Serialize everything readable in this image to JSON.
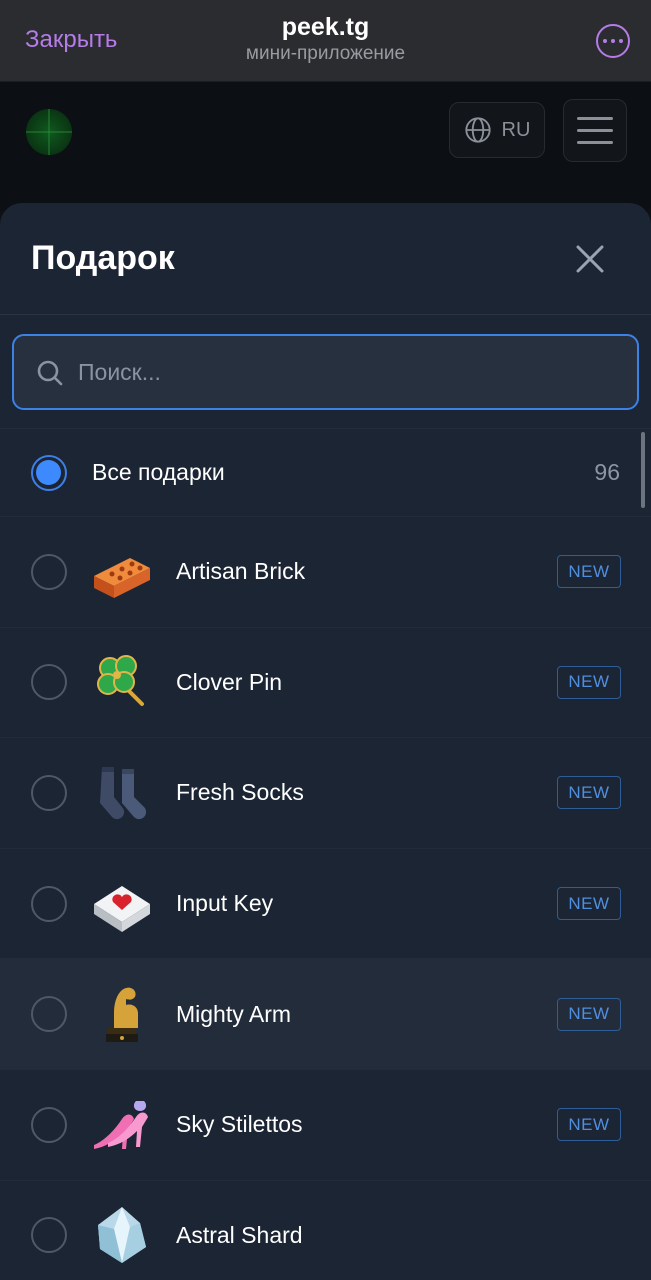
{
  "telegram_bar": {
    "close_label": "Закрыть",
    "title": "peek.tg",
    "subtitle": "мини-приложение",
    "more_icon": "more-horizontal-icon"
  },
  "app_header": {
    "logo_icon": "radar-icon",
    "language_label": "RU",
    "language_icon": "globe-icon",
    "menu_icon": "hamburger-menu-icon"
  },
  "modal": {
    "title": "Подарок",
    "close_icon": "close-icon",
    "search": {
      "placeholder": "Поиск...",
      "value": "",
      "icon": "search-icon"
    },
    "all_gifts": {
      "label": "Все подарки",
      "count": "96",
      "selected": true
    },
    "items": [
      {
        "name": "Artisan Brick",
        "badge": "NEW",
        "icon": "brick-icon",
        "selected": false
      },
      {
        "name": "Clover Pin",
        "badge": "NEW",
        "icon": "clover-pin-icon",
        "selected": false
      },
      {
        "name": "Fresh Socks",
        "badge": "NEW",
        "icon": "socks-icon",
        "selected": false
      },
      {
        "name": "Input Key",
        "badge": "NEW",
        "icon": "heart-key-icon",
        "selected": false
      },
      {
        "name": "Mighty Arm",
        "badge": "NEW",
        "icon": "mighty-arm-trophy-icon",
        "selected": false
      },
      {
        "name": "Sky Stilettos",
        "badge": "NEW",
        "icon": "stiletto-icon",
        "selected": false
      },
      {
        "name": "Astral Shard",
        "badge": "",
        "icon": "crystal-shard-icon",
        "selected": false
      }
    ]
  },
  "colors": {
    "accent_purple": "#b57ce8",
    "accent_blue": "#3d8aff",
    "sheet_bg": "#1c2533",
    "badge_blue": "#4f8fe0"
  }
}
